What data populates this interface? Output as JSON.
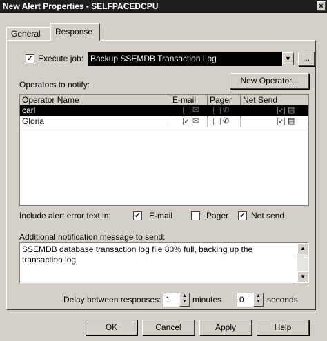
{
  "window": {
    "title": "New Alert Properties - SELFPACEDCPU",
    "close_label": "×"
  },
  "tabs": [
    {
      "label": "General"
    },
    {
      "label": "Response"
    }
  ],
  "execute_job": {
    "label": "Execute job:",
    "checked": true,
    "value": "Backup SSEMDB Transaction Log",
    "browse_label": "..."
  },
  "operators": {
    "label": "Operators to notify:",
    "new_operator_label": "New Operator...",
    "columns": [
      "Operator Name",
      "E-mail",
      "Pager",
      "Net Send"
    ],
    "rows": [
      {
        "name": "carl",
        "email": false,
        "pager": false,
        "net_send": true,
        "selected": true
      },
      {
        "name": "Gloria",
        "email": true,
        "pager": false,
        "net_send": true,
        "selected": false
      }
    ]
  },
  "include_alert": {
    "label": "Include alert error text in:",
    "email_label": "E-mail",
    "email_checked": true,
    "pager_label": "Pager",
    "pager_checked": false,
    "netsend_label": "Net send",
    "netsend_checked": true
  },
  "additional_message": {
    "label": "Additional notification message to send:",
    "value": "SSEMDB database transaction log file 80% full, backing up the transaction log"
  },
  "delay": {
    "label": "Delay between responses:",
    "minutes_value": "1",
    "minutes_label": "minutes",
    "seconds_value": "0",
    "seconds_label": "seconds"
  },
  "buttons": {
    "ok": "OK",
    "cancel": "Cancel",
    "apply": "Apply",
    "help": "Help"
  }
}
